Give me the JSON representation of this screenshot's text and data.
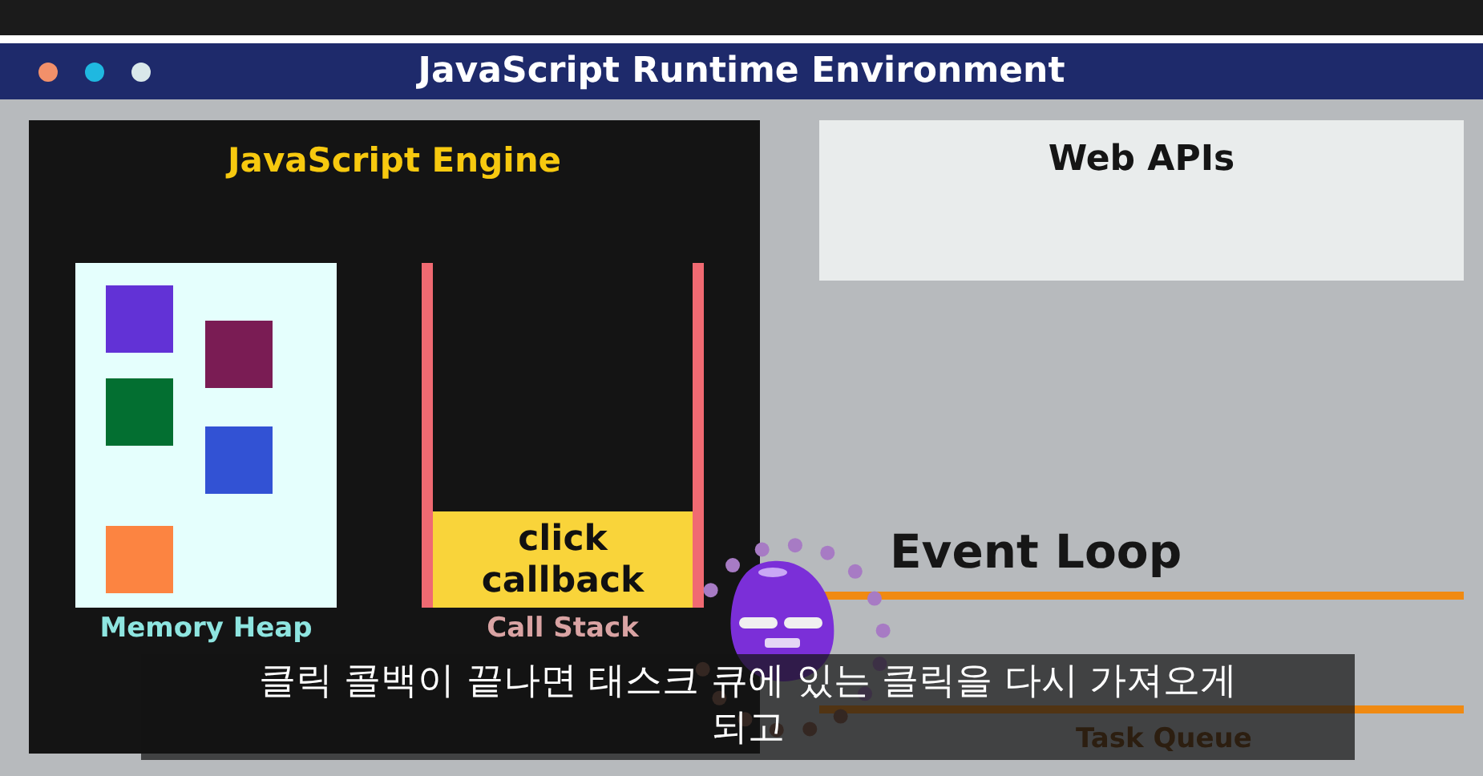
{
  "window": {
    "title": "JavaScript Runtime Environment",
    "controls": [
      {
        "color": "#f2906a"
      },
      {
        "color": "#1fb8e0"
      },
      {
        "color": "#d9e8ea"
      }
    ]
  },
  "engine": {
    "title": "JavaScript Engine",
    "memory_heap": {
      "label": "Memory Heap",
      "blocks": [
        {
          "color": "#6232d6"
        },
        {
          "color": "#7a1c54"
        },
        {
          "color": "#036f31"
        },
        {
          "color": "#3252d4"
        },
        {
          "color": "#fc8441"
        }
      ]
    },
    "call_stack": {
      "label": "Call Stack",
      "frames": [
        {
          "label": "click callback"
        }
      ]
    }
  },
  "web_apis": {
    "title": "Web APIs"
  },
  "event_loop": {
    "label": "Event Loop"
  },
  "task_queue": {
    "label": "Task Queue"
  },
  "subtitle": {
    "lines": [
      "클릭 콜백이 끝나면 태스크 큐에 있는 클릭을 다시 가져오게",
      "되고"
    ]
  }
}
